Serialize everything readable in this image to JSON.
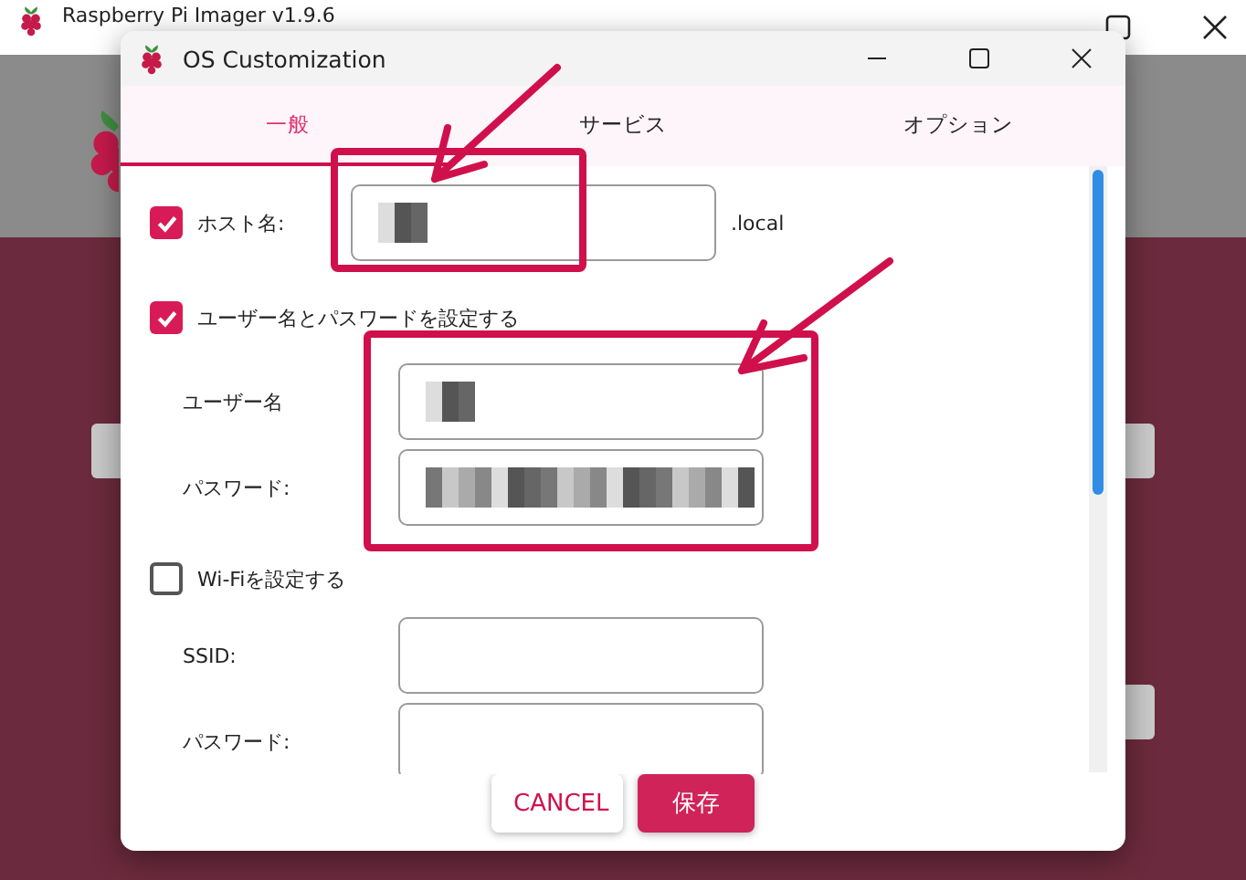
{
  "background_window": {
    "title": "Raspberry Pi Imager v1.9.6"
  },
  "dialog": {
    "title": "OS Customization",
    "tabs": [
      {
        "label": "一般",
        "selected": true
      },
      {
        "label": "サービス",
        "selected": false
      },
      {
        "label": "オプション",
        "selected": false
      }
    ],
    "hostname": {
      "checked": true,
      "label": "ホスト名:",
      "suffix": ".local",
      "blurred": true
    },
    "credentials": {
      "checked": true,
      "label": "ユーザー名とパスワードを設定する",
      "fields": [
        {
          "label": "ユーザー名",
          "blurred": true
        },
        {
          "label": "パスワード:",
          "blurred": true
        }
      ]
    },
    "wifi": {
      "checked": false,
      "label": "Wi-Fiを設定する",
      "fields": [
        {
          "label": "SSID:",
          "blurred": false
        },
        {
          "label": "パスワード:",
          "blurred": false
        }
      ]
    },
    "buttons": [
      {
        "label": "CANCEL",
        "kind": "secondary"
      },
      {
        "label": "保存",
        "kind": "primary"
      }
    ]
  }
}
